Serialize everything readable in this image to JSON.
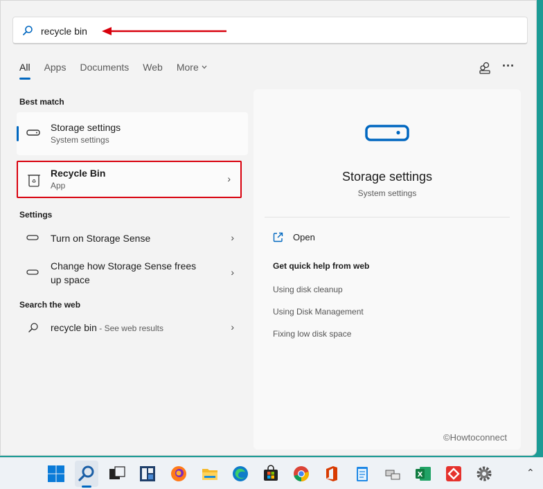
{
  "search": {
    "query": "recycle bin"
  },
  "tabs": [
    {
      "label": "All",
      "active": true
    },
    {
      "label": "Apps"
    },
    {
      "label": "Documents"
    },
    {
      "label": "Web"
    },
    {
      "label": "More"
    }
  ],
  "best_match": {
    "title": "Best match",
    "items": [
      {
        "title": "Storage settings",
        "subtitle": "System settings"
      },
      {
        "title": "Recycle Bin",
        "subtitle": "App"
      }
    ]
  },
  "settings": {
    "title": "Settings",
    "items": [
      {
        "title": "Turn on Storage Sense"
      },
      {
        "title": "Change how Storage Sense frees",
        "title2": "up space"
      }
    ]
  },
  "web": {
    "title": "Search the web",
    "query": "recycle bin",
    "suffix": " - See web results"
  },
  "preview": {
    "title": "Storage settings",
    "subtitle": "System settings",
    "open_label": "Open",
    "help_title": "Get quick help from web",
    "links": [
      "Using disk cleanup",
      "Using Disk Management",
      "Fixing low disk space"
    ]
  },
  "watermark": "©Howtoconnect",
  "colors": {
    "accent": "#0067c0",
    "highlight": "#d8000c",
    "background": "#1c9b95"
  },
  "taskbar": {
    "icons": [
      "windows-start-icon",
      "search-icon",
      "task-view-icon",
      "widgets-icon",
      "firefox-icon",
      "file-explorer-icon",
      "edge-icon",
      "store-icon",
      "chrome-icon",
      "office-icon",
      "notepad-icon",
      "network-icon",
      "excel-icon",
      "anydesk-icon",
      "settings-icon"
    ]
  }
}
